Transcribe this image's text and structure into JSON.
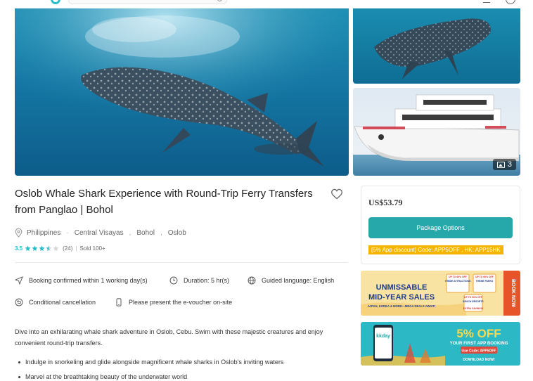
{
  "listing": {
    "title": "Oslob Whale Shark Experience with Round-Trip Ferry Transfers from Panglao | Bohol",
    "location": {
      "country": "Philippines",
      "region": "Central Visayas",
      "province": "Bohol",
      "city": "Oslob"
    },
    "rating": {
      "score": "3.5",
      "stars": 3.5,
      "count": "(24)",
      "divider": "|",
      "sold": "Sold 100+"
    },
    "gallery": {
      "photo_count": "3"
    }
  },
  "features": {
    "confirmation": "Booking confirmed within 1 working day(s)",
    "duration": "Duration: 5 hr(s)",
    "language": "Guided language: English",
    "cancellation": "Conditional cancellation",
    "voucher": "Please present the e-voucher on-site"
  },
  "description": {
    "intro": "Dive into an exhilarating whale shark adventure in Oslob, Cebu. Swim with these majestic creatures and enjoy convenient round-trip transfers.",
    "bullets": [
      "Indulge in snorkeling and glide alongside magnificent whale sharks in Oslob's inviting waters",
      "Marvel at the breathtaking beauty of the underwater world"
    ]
  },
  "booking": {
    "price": "US$53.79",
    "package_button": "Package Options",
    "promo": "[5% App discount] Code: APP5OFF , HK: APP15HK"
  },
  "banners": {
    "sale": {
      "line1": "UNMISSABLE",
      "line2": "MID-YEAR SALES",
      "sub": "JAPAN, KOREA & MORE—MEGA DEALS AWAIT!",
      "side": "BOOK NOW",
      "tag1": "UP TO 60% OFF",
      "tag2": "UP TO 60% OFF",
      "tag3": "UP TO 50% OFF",
      "tag4": "THEME ATTRACTIONS",
      "tag5": "THEME PARKS",
      "tag6": "BEACH RESORTS",
      "tag7": "EXTRA SAVINGS!"
    },
    "app": {
      "brand": "kkday",
      "headline": "5% OFF",
      "line": "YOUR FIRST APP BOOKING",
      "code": "Use Code: APP5OFF",
      "cta": "DOWNLOAD NOW!"
    }
  },
  "colors": {
    "accent": "#26a7a9",
    "star": "#26bec9",
    "promo": "#f5b400"
  }
}
